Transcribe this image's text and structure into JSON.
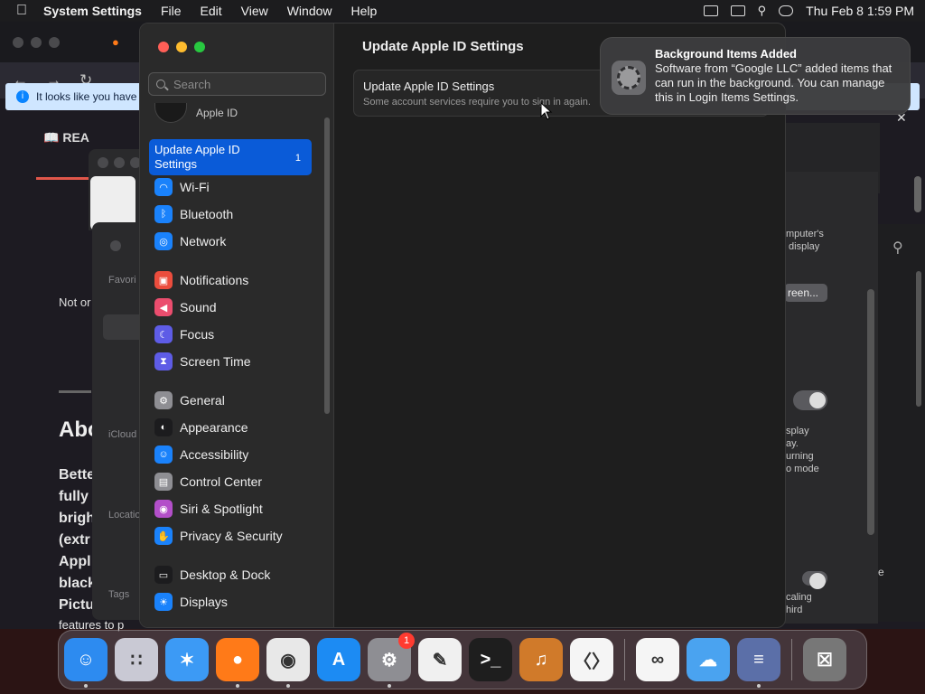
{
  "menubar": {
    "app_name": "System Settings",
    "menus": [
      "File",
      "Edit",
      "View",
      "Window",
      "Help"
    ],
    "clock": "Thu Feb 8  1:59 PM"
  },
  "firefox": {
    "info_bar": "It looks like you have",
    "reader_label": "REA",
    "not_online": "Not or",
    "heading": "Abo",
    "body_lines": [
      "Bette",
      "fully",
      "brigh",
      "(extr",
      "Appl",
      "black",
      "Pictu",
      "features to p"
    ]
  },
  "finder": {
    "favorites": "Favori",
    "icloud": "iCloud",
    "locations": "Locatio",
    "tags": "Tags"
  },
  "behind_window": {
    "text1": "mputer's\n display",
    "button": "reen...",
    "text2": "splay\nay.\nurning\no mode",
    "text3": "caling\nhird",
    "edge_text": "e"
  },
  "settings": {
    "search_placeholder": "Search",
    "apple_id_label": "Apple ID",
    "update_item": {
      "label": "Update Apple ID Settings",
      "badge": "1"
    },
    "groups": [
      [
        {
          "label": "Wi-Fi",
          "icon": "wifi-icon",
          "color": "#1a82fb"
        },
        {
          "label": "Bluetooth",
          "icon": "bluetooth-icon",
          "color": "#1a82fb"
        },
        {
          "label": "Network",
          "icon": "network-icon",
          "color": "#1a82fb"
        }
      ],
      [
        {
          "label": "Notifications",
          "icon": "notifications-icon",
          "color": "#eb4d3d"
        },
        {
          "label": "Sound",
          "icon": "sound-icon",
          "color": "#eb4d6e"
        },
        {
          "label": "Focus",
          "icon": "focus-icon",
          "color": "#5e5ce6"
        },
        {
          "label": "Screen Time",
          "icon": "screen-time-icon",
          "color": "#5e5ce6"
        }
      ],
      [
        {
          "label": "General",
          "icon": "general-icon",
          "color": "#8e8e93"
        },
        {
          "label": "Appearance",
          "icon": "appearance-icon",
          "color": "#1c1c1e"
        },
        {
          "label": "Accessibility",
          "icon": "accessibility-icon",
          "color": "#1a82fb"
        },
        {
          "label": "Control Center",
          "icon": "control-center-icon",
          "color": "#8e8e93"
        },
        {
          "label": "Siri & Spotlight",
          "icon": "siri-icon",
          "color": "#b34fc9"
        },
        {
          "label": "Privacy & Security",
          "icon": "privacy-icon",
          "color": "#1a82fb"
        }
      ],
      [
        {
          "label": "Desktop & Dock",
          "icon": "desktop-dock-icon",
          "color": "#1c1c1e"
        },
        {
          "label": "Displays",
          "icon": "displays-icon",
          "color": "#1a82fb"
        }
      ]
    ],
    "main_title": "Update Apple ID Settings",
    "card_title": "Update Apple ID Settings",
    "card_subtitle": "Some account services require you to sign in again."
  },
  "notification": {
    "title": "Background Items Added",
    "body": "Software from “Google LLC” added items that can run in the background. You can manage this in Login Items Settings."
  },
  "dock": {
    "apps": [
      {
        "name": "finder-app",
        "glyph": "☺",
        "color": "#2d8bf0",
        "running": true
      },
      {
        "name": "launchpad-app",
        "glyph": "∷",
        "color": "#c9c9d4",
        "running": false
      },
      {
        "name": "safari-app",
        "glyph": "✶",
        "color": "#3c9af5",
        "running": false
      },
      {
        "name": "firefox-app",
        "glyph": "●",
        "color": "#ff7a18",
        "running": true
      },
      {
        "name": "chrome-app",
        "glyph": "◉",
        "color": "#e8e8e8",
        "running": true
      },
      {
        "name": "app-store-app",
        "glyph": "A",
        "color": "#1c8bf3",
        "running": false
      },
      {
        "name": "system-settings-app",
        "glyph": "⚙",
        "color": "#8e8e93",
        "running": true,
        "badge": "1"
      },
      {
        "name": "textedit-app",
        "glyph": "✎",
        "color": "#f0f0f0",
        "running": false
      },
      {
        "name": "terminal-app",
        "glyph": ">_",
        "color": "#1e1e1e",
        "running": false
      },
      {
        "name": "garageband-app",
        "glyph": "♫",
        "color": "#d07a2a",
        "running": false
      },
      {
        "name": "vscode-app",
        "glyph": "〈〉",
        "color": "#f5f5f5",
        "running": false
      }
    ],
    "recent": [
      {
        "name": "visual-studio-app",
        "glyph": "∞",
        "color": "#f5f5f5",
        "running": false
      },
      {
        "name": "weather-app",
        "glyph": "☁",
        "color": "#4aa3f0",
        "running": false
      },
      {
        "name": "taskbar-app",
        "glyph": "≡",
        "color": "#5b6fa8",
        "running": true
      }
    ],
    "trash": {
      "name": "trash-app",
      "glyph": "☒",
      "color": "#777"
    }
  }
}
